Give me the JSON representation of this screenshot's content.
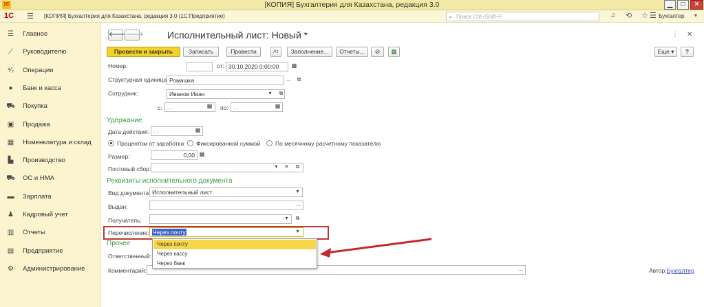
{
  "window": {
    "title": "[КОПИЯ] Бухгалтерия для Казахстана, редакция 3.0",
    "min": "▁",
    "max": "□",
    "close": "✕"
  },
  "app": {
    "logo": "1С",
    "breadcrumb": "[КОПИЯ] Бухгалтерия для Казахстана, редакция 3.0 (1С:Предприятие)",
    "search_placeholder": "Поиск Ctrl+Shift+F",
    "user": "Бухгалтер"
  },
  "sidebar": {
    "items": [
      {
        "label": "Главное",
        "icon": "menu-icon",
        "glyph": "☰"
      },
      {
        "label": "Руководителю",
        "icon": "chart-line-icon",
        "glyph": "⟋"
      },
      {
        "label": "Операции",
        "icon": "operations-icon",
        "glyph": "⁴⁄₇"
      },
      {
        "label": "Банк и касса",
        "icon": "bank-icon",
        "glyph": "●"
      },
      {
        "label": "Покупка",
        "icon": "cart-icon",
        "glyph": "⛟"
      },
      {
        "label": "Продажа",
        "icon": "bag-icon",
        "glyph": "▣"
      },
      {
        "label": "Номенклатура и склад",
        "icon": "warehouse-icon",
        "glyph": "▦"
      },
      {
        "label": "Производство",
        "icon": "factory-icon",
        "glyph": "▙"
      },
      {
        "label": "ОС и НМА",
        "icon": "assets-icon",
        "glyph": "⛟"
      },
      {
        "label": "Зарплата",
        "icon": "salary-icon",
        "glyph": "▬"
      },
      {
        "label": "Кадровый учет",
        "icon": "people-icon",
        "glyph": "♟"
      },
      {
        "label": "Отчеты",
        "icon": "reports-icon",
        "glyph": "▥"
      },
      {
        "label": "Предприятие",
        "icon": "enterprise-icon",
        "glyph": "▤"
      },
      {
        "label": "Администрирование",
        "icon": "gear-icon",
        "glyph": "⚙"
      }
    ]
  },
  "form": {
    "title": "Исполнительный лист: Новый *",
    "toolbar": {
      "post_close": "Провести и закрыть",
      "save": "Записать",
      "post": "Провести",
      "fill": "Заполнение...",
      "reports": "Отчеты...",
      "more": "Еще",
      "help": "?"
    },
    "number": {
      "label": "Номер:",
      "value": ""
    },
    "date": {
      "label": "от:",
      "value": "30.10.2020  0:00:00"
    },
    "unit": {
      "label": "Структурная единица:",
      "value": "Ромашка"
    },
    "employee": {
      "label": "Сотрудник:",
      "value": "Иванов Иван"
    },
    "period": {
      "from_label": "с:",
      "from_value": " .  .",
      "to_label": "по:",
      "to_value": " .  ."
    },
    "deduction": {
      "header": "Удержание",
      "action_date_label": "Дата действия:",
      "action_date_value": " .  .",
      "radios": [
        "Процентом от заработка",
        "Фиксированной суммой",
        "По месячному расчетному показателю"
      ],
      "size_label": "Размер:",
      "size_value": "0,00",
      "postal_label": "Почтовый сбор:",
      "postal_value": ""
    },
    "requisites": {
      "header": "Реквизиты исполнительного документа",
      "doc_type_label": "Вид документа:",
      "doc_type_value": "Исполнительный лист",
      "issued_label": "Выдан:",
      "issued_value": "",
      "recipient_label": "Получатель:",
      "recipient_value": "",
      "transfer_label": "Перечисление:",
      "transfer_value": "Через почту"
    },
    "other": {
      "header": "Прочее",
      "responsible_label": "Ответственный:",
      "comment_label": "Комментарий:",
      "comment_value": "",
      "author_label": "Автор:",
      "author_value": "Бухгалтер"
    },
    "dropdown": {
      "options": [
        "Через почту",
        "Через кассу",
        "Через банк"
      ],
      "selected": "Через почту"
    }
  },
  "colors": {
    "accent": "#f5d22a",
    "section": "#3f9b43",
    "highlight_border": "#b83838",
    "arrow": "#c0282c"
  }
}
